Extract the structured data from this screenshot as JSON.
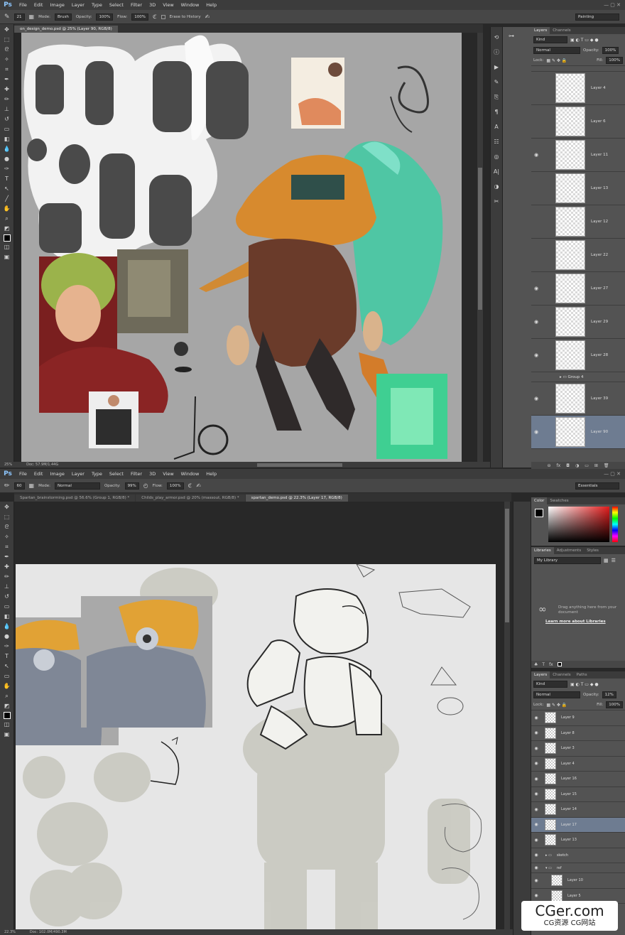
{
  "top": {
    "menu": [
      "File",
      "Edit",
      "Image",
      "Layer",
      "Type",
      "Select",
      "Filter",
      "3D",
      "View",
      "Window",
      "Help"
    ],
    "options": {
      "brush_size": "21",
      "mode_label": "Mode:",
      "mode_value": "Brush",
      "opacity_label": "Opacity:",
      "opacity_value": "100%",
      "flow_label": "Flow:",
      "flow_value": "100%",
      "erase_history": "Erase to History",
      "workspace": "Painting"
    },
    "doc_tab": "on_design_demo.psd @ 25% (Layer 90, RGB/8)",
    "status": {
      "zoom": "25%",
      "doc": "Doc: 57.9M/1.44G"
    },
    "layers_panel": {
      "tabs": [
        "Layers",
        "Channels"
      ],
      "kind": "Kind",
      "blend": "Normal",
      "opacity_label": "Opacity:",
      "opacity_value": "100%",
      "lock_label": "Lock:",
      "fill_label": "Fill:",
      "fill_value": "100%",
      "layers": [
        {
          "name": "Layer 4",
          "visible": false
        },
        {
          "name": "Layer 6",
          "visible": false
        },
        {
          "name": "Layer 11",
          "visible": true
        },
        {
          "name": "Layer 13",
          "visible": false
        },
        {
          "name": "Layer 12",
          "visible": false
        },
        {
          "name": "Layer 22",
          "visible": false
        },
        {
          "name": "Layer 27",
          "visible": true
        },
        {
          "name": "Layer 29",
          "visible": true
        },
        {
          "name": "Layer 28",
          "visible": true
        }
      ],
      "group": "Group 4",
      "layers_bottom": [
        {
          "name": "Layer 39",
          "visible": true
        },
        {
          "name": "Layer 90",
          "visible": true,
          "selected": true
        }
      ]
    }
  },
  "bottom": {
    "menu": [
      "File",
      "Edit",
      "Image",
      "Layer",
      "Type",
      "Select",
      "Filter",
      "3D",
      "View",
      "Window",
      "Help"
    ],
    "options": {
      "brush_size": "60",
      "mode_label": "Mode:",
      "mode_value": "Normal",
      "opacity_label": "Opacity:",
      "opacity_value": "99%",
      "flow_label": "Flow:",
      "flow_value": "100%",
      "workspace": "Essentials"
    },
    "tabs": [
      "Spartan_brainstorming.psd @ 56.6% (Group 1, RGB/8) *",
      "Childs_play_armor.psd @ 20% (massout, RGB/8) *",
      "spartan_demo.psd @ 22.3% (Layer 17, RGB/8)"
    ],
    "status": {
      "zoom": "22.3%",
      "doc": "Doc: 102.0M/490.3M"
    },
    "color_panel": {
      "tabs": [
        "Color",
        "Swatches"
      ]
    },
    "libraries_panel": {
      "tabs": [
        "Libraries",
        "Adjustments",
        "Styles"
      ],
      "library": "My Library",
      "drag_text": "Drag anything here from your document",
      "learn_more": "Learn more about Libraries"
    },
    "layers_panel": {
      "tabs": [
        "Layers",
        "Channels",
        "Paths"
      ],
      "kind": "Kind",
      "blend": "Normal",
      "opacity_label": "Opacity:",
      "opacity_value": "12%",
      "lock_label": "Lock:",
      "fill_label": "Fill:",
      "fill_value": "100%",
      "layers": [
        {
          "name": "Layer 9",
          "selected": false
        },
        {
          "name": "Layer 8",
          "selected": false
        },
        {
          "name": "Layer 3",
          "selected": false
        },
        {
          "name": "Layer 4",
          "selected": false
        },
        {
          "name": "Layer 16",
          "selected": false
        },
        {
          "name": "Layer 15",
          "selected": false
        },
        {
          "name": "Layer 14",
          "selected": false
        },
        {
          "name": "Layer 17",
          "selected": true
        },
        {
          "name": "Layer 13",
          "selected": false
        }
      ],
      "groups": [
        "sketch",
        "ref"
      ],
      "ref_layers": [
        "Layer 10",
        "Layer 5"
      ]
    }
  },
  "watermark": {
    "line1": "CGer.com",
    "line2": "CG资源 CG网站"
  },
  "colors": {
    "canvas_top": "#a6a6a6",
    "canvas_bottom": "#e6e6e6",
    "selected_layer": "#6e7c91",
    "orange": "#d78a2e",
    "teal": "#4fc6a4"
  }
}
